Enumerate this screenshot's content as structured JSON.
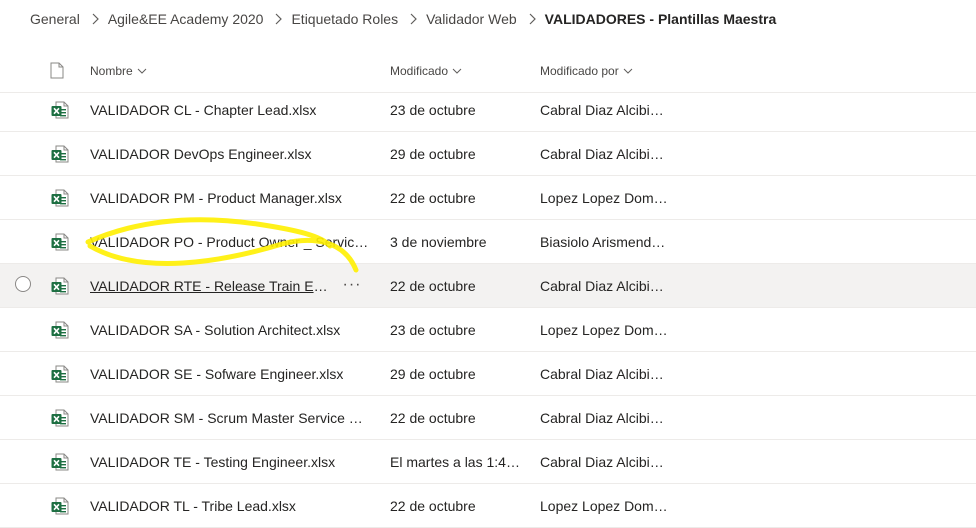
{
  "breadcrumb": {
    "items": [
      "General",
      "Agile&EE Academy 2020",
      "Etiquetado Roles",
      "Validador Web"
    ],
    "current": "VALIDADORES - Plantillas Maestra"
  },
  "columns": {
    "name": "Nombre",
    "modified": "Modificado",
    "modified_by": "Modificado por"
  },
  "file_icon": "excel-file-icon",
  "more_actions": "···",
  "files": [
    {
      "name": "VALIDADOR CL - Chapter Lead.xlsx",
      "modified": "23 de octubre",
      "modified_by": "Cabral Diaz Alcibia..."
    },
    {
      "name": "VALIDADOR DevOps Engineer.xlsx",
      "modified": "29 de octubre",
      "modified_by": "Cabral Diaz Alcibia..."
    },
    {
      "name": "VALIDADOR PM - Product Manager.xlsx",
      "modified": "22 de octubre",
      "modified_by": "Lopez Lopez Domi..."
    },
    {
      "name": "VALIDADOR PO - Product Owner _ Service ...",
      "modified": "3 de noviembre",
      "modified_by": "Biasiolo Arismendi ..."
    },
    {
      "name": "VALIDADOR RTE - Release Train Engin...",
      "modified": "22 de octubre",
      "modified_by": "Cabral Diaz Alcibia..."
    },
    {
      "name": "VALIDADOR SA - Solution Architect.xlsx",
      "modified": "23 de octubre",
      "modified_by": "Lopez Lopez Domi..."
    },
    {
      "name": "VALIDADOR SE - Sofware Engineer.xlsx",
      "modified": "29 de octubre",
      "modified_by": "Cabral Diaz Alcibia..."
    },
    {
      "name": "VALIDADOR SM - Scrum Master Service Del...",
      "modified": "22 de octubre",
      "modified_by": "Cabral Diaz Alcibia..."
    },
    {
      "name": "VALIDADOR TE - Testing Engineer.xlsx",
      "modified": "El martes a las 1:48...",
      "modified_by": "Cabral Diaz Alcibia..."
    },
    {
      "name": "VALIDADOR TL - Tribe Lead.xlsx",
      "modified": "22 de octubre",
      "modified_by": "Lopez Lopez Domi..."
    }
  ],
  "colors": {
    "excel_green": "#1d6f42",
    "highlighter": "#ffef00",
    "hover_row": "#f3f2f1"
  }
}
